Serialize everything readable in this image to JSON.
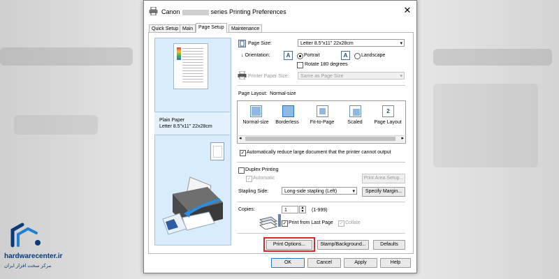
{
  "window": {
    "title_prefix": "Canon",
    "title_suffix": "series Printing Preferences"
  },
  "tabs": [
    "Quick Setup",
    "Main",
    "Page Setup",
    "Maintenance"
  ],
  "active_tab": "Page Setup",
  "preview": {
    "media_line1": "Plain Paper",
    "media_line2": "Letter 8.5\"x11\" 22x28cm"
  },
  "page_size": {
    "label": "Page Size:",
    "value": "Letter 8.5\"x11\" 22x28cm"
  },
  "orientation": {
    "label": "Orientation:",
    "portrait": "Portrait",
    "landscape": "Landscape",
    "rotate_label": "Rotate 180 degrees",
    "icon_letter": "A"
  },
  "printer_paper_size": {
    "label": "Printer Paper Size:",
    "value": "Same as Page Size"
  },
  "page_layout": {
    "label": "Page Layout:",
    "current": "Normal-size",
    "items": [
      "Normal-size",
      "Borderless",
      "Fit-to-Page",
      "Scaled",
      "Page Layout"
    ],
    "page_layout_badge": "2"
  },
  "auto_reduce_label": "Automatically reduce large document that the printer cannot output",
  "duplex": {
    "label": "Duplex Printing",
    "automatic_label": "Automatic",
    "print_area_setup": "Print Area Setup..."
  },
  "stapling": {
    "label": "Stapling Side:",
    "value": "Long-side stapling (Left)",
    "specify_margin": "Specify Margin..."
  },
  "copies": {
    "label": "Copies:",
    "value": "1",
    "range": "(1-999)",
    "print_from_last": "Print from Last Page",
    "collate": "Collate"
  },
  "buttons": {
    "print_options": "Print Options...",
    "stamp_background": "Stamp/Background...",
    "defaults": "Defaults",
    "ok": "OK",
    "cancel": "Cancel",
    "apply": "Apply",
    "help": "Help"
  },
  "watermark": {
    "site": "hardwarecenter.ir",
    "tagline": "مرکز سخت افزار ایران"
  },
  "colors": {
    "highlight_red": "#e32323",
    "preview_blue": "#d8ecfb",
    "default_button_border": "#2a73c9"
  }
}
